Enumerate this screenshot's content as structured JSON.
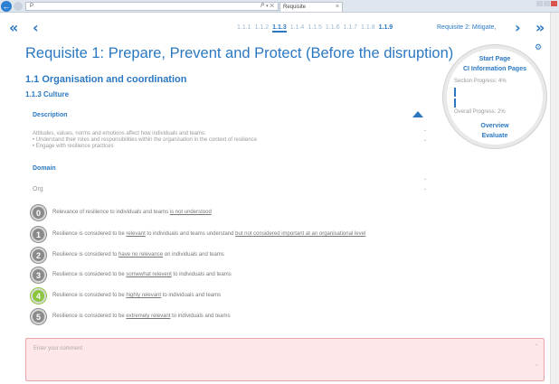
{
  "browser": {
    "address": "P",
    "address_controls": "𝛲 ▾ ✕",
    "tab_title": "Requisite",
    "tab_close": "×"
  },
  "nav": {
    "first": "«",
    "prev": "‹",
    "next": "›",
    "last": "»",
    "crumbs": [
      {
        "label": "1.1.1",
        "state": "normal"
      },
      {
        "label": "1.1.2",
        "state": "normal"
      },
      {
        "label": "1.1.3",
        "state": "active"
      },
      {
        "label": "1.1.4",
        "state": "normal"
      },
      {
        "label": "1.1.5",
        "state": "normal"
      },
      {
        "label": "1.1.6",
        "state": "normal"
      },
      {
        "label": "1.1.7",
        "state": "normal"
      },
      {
        "label": "1.1.8",
        "state": "normal"
      },
      {
        "label": "1.1.9",
        "state": "bold"
      }
    ],
    "next_requisite": "Requisite 2: Mitigate,"
  },
  "page_title": "Requisite 1: Prepare, Prevent and Protect (Before the disruption)",
  "section_title": "1.1 Organisation and coordination",
  "subsection_title": "1.1.3 Culture",
  "description": {
    "heading": "Description",
    "lines": [
      "Attitudes, values, norms and emotions affect how individuals and teams:",
      "• Understand their roles and responsibilities within the organisation in the context of resilience",
      "• Engage with resilience practices"
    ]
  },
  "domain": {
    "heading": "Domain",
    "value": "Org"
  },
  "options": [
    {
      "num": "0",
      "pre": "Relevance of resilience to individuals and teams ",
      "u1": "is not understood",
      "mid": "",
      "u2": "",
      "post": "",
      "selected": false
    },
    {
      "num": "1",
      "pre": "Resilience is considered to be ",
      "u1": "relevant",
      "mid": " to individuals and teams understand ",
      "u2": "but not considered important at an organisational level",
      "post": "",
      "selected": false
    },
    {
      "num": "2",
      "pre": "Resilience is considered to ",
      "u1": "have no relevance",
      "mid": " on individuals and teams",
      "u2": "",
      "post": "",
      "selected": false
    },
    {
      "num": "3",
      "pre": "Resilience is considered to be ",
      "u1": "somewhat relevent",
      "mid": " to individuals and teams",
      "u2": "",
      "post": "",
      "selected": false
    },
    {
      "num": "4",
      "pre": "Resilience is considered to be ",
      "u1": "highly relevant",
      "mid": " to individuals and teams",
      "u2": "",
      "post": "",
      "selected": true
    },
    {
      "num": "5",
      "pre": "Resilience is considered to be ",
      "u1": "extremely relevant",
      "mid": " to individuals and teams",
      "u2": "",
      "post": "",
      "selected": false
    }
  ],
  "comment": {
    "placeholder": "Enter your comment"
  },
  "overview": {
    "start_page": "Start Page",
    "ci_pages": "CI Information Pages",
    "section_progress": "Section Progress: 4%",
    "section_progress_value": 4,
    "overall_progress": "Overall Progress: 2%",
    "overall_progress_value": 2,
    "overview_link": "Overview",
    "evaluate_link": "Evaluate"
  },
  "icons": {
    "gear": "gear-icon",
    "collapse": "collapse-triangle-icon"
  },
  "colors": {
    "accent": "#2b78c2",
    "selected": "#8cc63f",
    "unselected": "#8a8a8a",
    "comment_bg": "#fde7e8"
  }
}
